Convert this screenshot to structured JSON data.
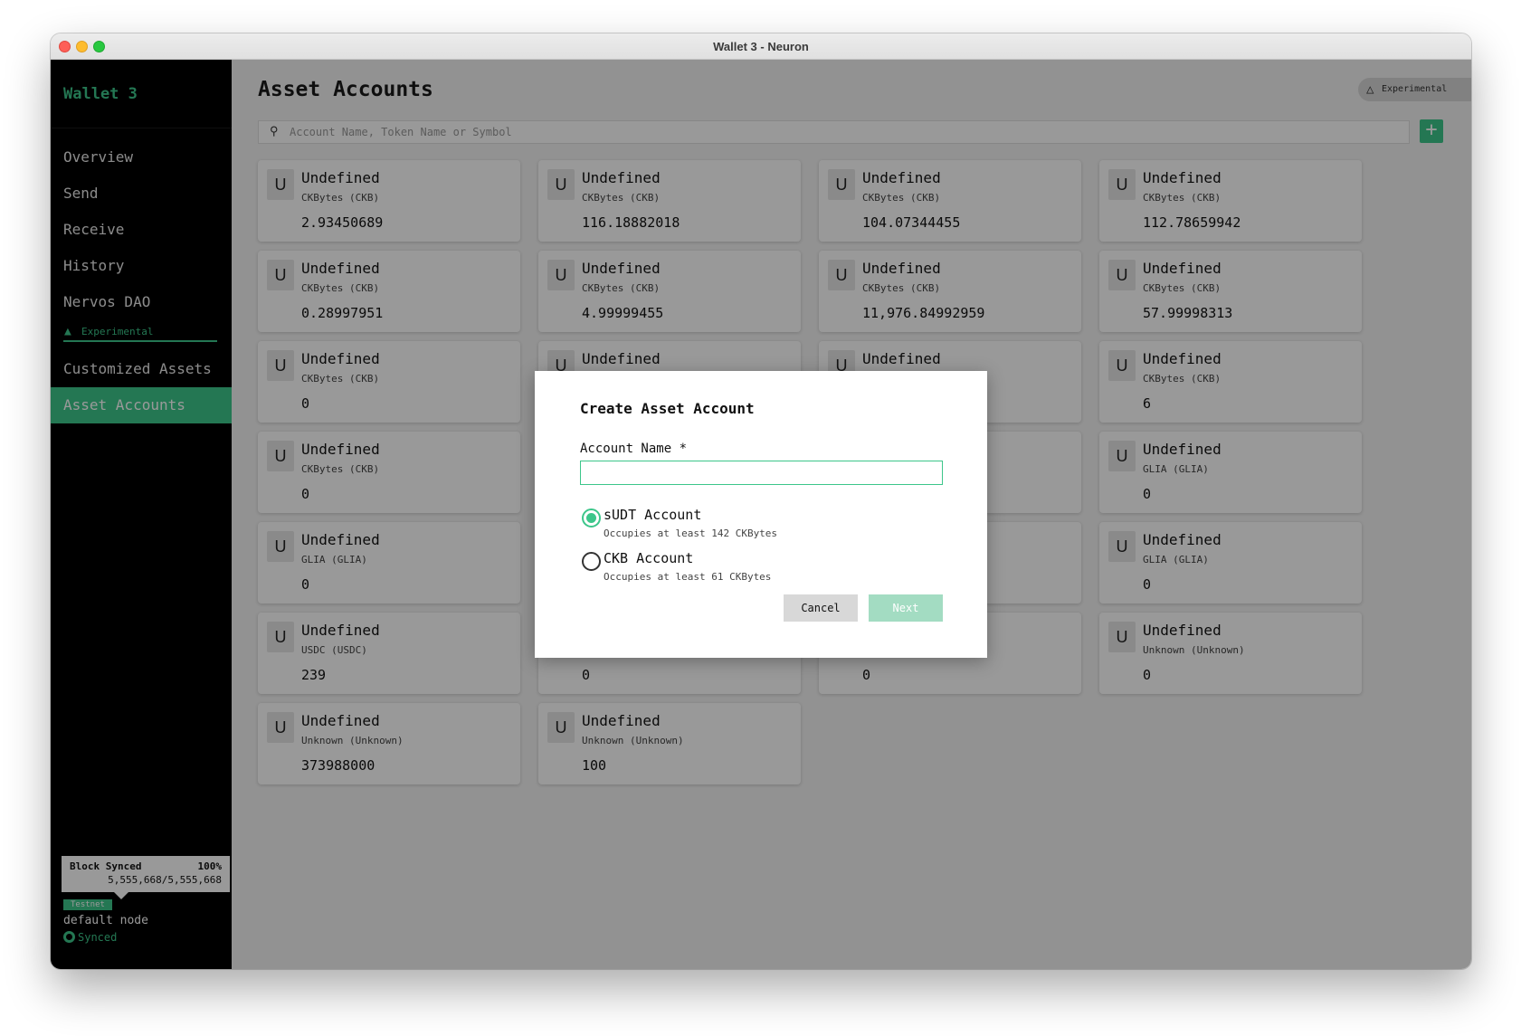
{
  "window": {
    "title": "Wallet 3 - Neuron"
  },
  "sidebar": {
    "wallet_name": "Wallet 3",
    "items": [
      {
        "label": "Overview"
      },
      {
        "label": "Send"
      },
      {
        "label": "Receive"
      },
      {
        "label": "History"
      },
      {
        "label": "Nervos DAO"
      },
      {
        "label": "Customized Assets"
      },
      {
        "label": "Asset Accounts",
        "active": true
      }
    ],
    "experimental_label": "Experimental",
    "sync": {
      "title": "Block Synced",
      "percent": "100%",
      "blocks": "5,555,668/5,555,668"
    },
    "network_badge": "Testnet",
    "node_name": "default node",
    "node_status": "Synced"
  },
  "header": {
    "title": "Asset Accounts",
    "experimental": "Experimental",
    "search_placeholder": "Account Name, Token Name or Symbol",
    "add_label": "+"
  },
  "accounts": [
    {
      "avatar": "U",
      "name": "Undefined",
      "token": "CKBytes (CKB)",
      "amount": "2.93450689"
    },
    {
      "avatar": "U",
      "name": "Undefined",
      "token": "CKBytes (CKB)",
      "amount": "116.18882018"
    },
    {
      "avatar": "U",
      "name": "Undefined",
      "token": "CKBytes (CKB)",
      "amount": "104.07344455"
    },
    {
      "avatar": "U",
      "name": "Undefined",
      "token": "CKBytes (CKB)",
      "amount": "112.78659942"
    },
    {
      "avatar": "U",
      "name": "Undefined",
      "token": "CKBytes (CKB)",
      "amount": "0.28997951"
    },
    {
      "avatar": "U",
      "name": "Undefined",
      "token": "CKBytes (CKB)",
      "amount": "4.99999455"
    },
    {
      "avatar": "U",
      "name": "Undefined",
      "token": "CKBytes (CKB)",
      "amount": "11,976.84992959"
    },
    {
      "avatar": "U",
      "name": "Undefined",
      "token": "CKBytes (CKB)",
      "amount": "57.99998313"
    },
    {
      "avatar": "U",
      "name": "Undefined",
      "token": "CKBytes (CKB)",
      "amount": "0"
    },
    {
      "avatar": "U",
      "name": "Undefined",
      "token": "",
      "amount": ""
    },
    {
      "avatar": "U",
      "name": "Undefined",
      "token": "",
      "amount": ""
    },
    {
      "avatar": "U",
      "name": "Undefined",
      "token": "CKBytes (CKB)",
      "amount": "6"
    },
    {
      "avatar": "U",
      "name": "Undefined",
      "token": "CKBytes (CKB)",
      "amount": "0"
    },
    {
      "avatar": "",
      "name": "",
      "token": "",
      "amount": ""
    },
    {
      "avatar": "",
      "name": "",
      "token": "",
      "amount": ""
    },
    {
      "avatar": "U",
      "name": "Undefined",
      "token": "GLIA (GLIA)",
      "amount": "0"
    },
    {
      "avatar": "U",
      "name": "Undefined",
      "token": "GLIA (GLIA)",
      "amount": "0"
    },
    {
      "avatar": "",
      "name": "",
      "token": "",
      "amount": ""
    },
    {
      "avatar": "",
      "name": "",
      "token": "",
      "amount": ""
    },
    {
      "avatar": "U",
      "name": "Undefined",
      "token": "GLIA (GLIA)",
      "amount": "0"
    },
    {
      "avatar": "U",
      "name": "Undefined",
      "token": "USDC (USDC)",
      "amount": "239"
    },
    {
      "avatar": "",
      "name": "",
      "token": "",
      "amount": "0"
    },
    {
      "avatar": "",
      "name": "",
      "token": "",
      "amount": "0"
    },
    {
      "avatar": "U",
      "name": "Undefined",
      "token": "Unknown (Unknown)",
      "amount": "0"
    },
    {
      "avatar": "U",
      "name": "Undefined",
      "token": "Unknown (Unknown)",
      "amount": "373988000"
    },
    {
      "avatar": "U",
      "name": "Undefined",
      "token": "Unknown (Unknown)",
      "amount": "100"
    }
  ],
  "modal": {
    "title": "Create Asset Account",
    "name_label": "Account Name *",
    "name_value": "",
    "options": [
      {
        "label": "sUDT Account",
        "sub": "Occupies at least 142 CKBytes",
        "checked": true
      },
      {
        "label": "CKB Account",
        "sub": "Occupies at least 61 CKBytes",
        "checked": false
      }
    ],
    "cancel_label": "Cancel",
    "next_label": "Next"
  },
  "colors": {
    "accent": "#3cc68a",
    "sidebar": "#000000"
  }
}
